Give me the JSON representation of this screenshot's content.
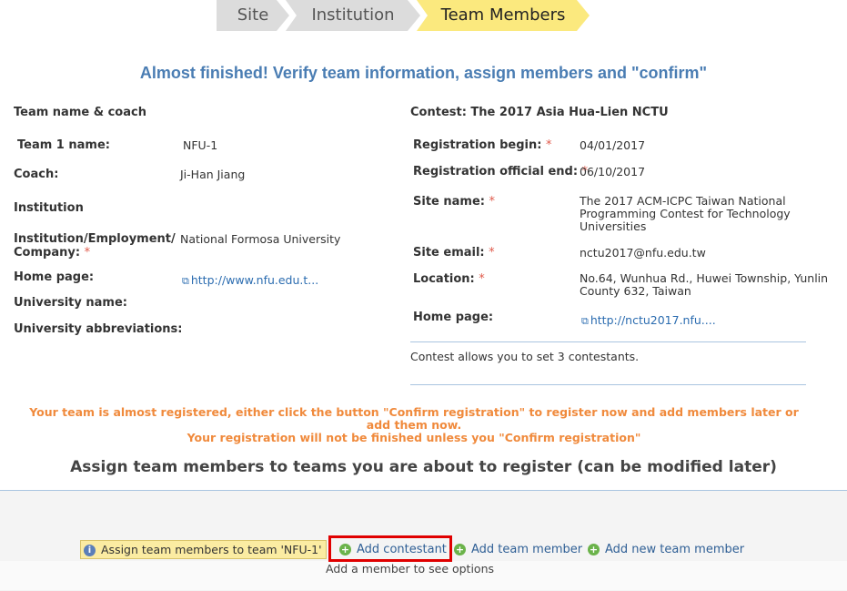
{
  "breadcrumb": {
    "steps": [
      "Site",
      "Institution",
      "Team Members"
    ]
  },
  "headline": "Almost finished! Verify team information, assign members and \"confirm\"",
  "team": {
    "section_title": "Team name & coach",
    "name_label": "Team 1 name:",
    "name_value": "NFU-1",
    "coach_label": "Coach:",
    "coach_value": "Ji-Han Jiang",
    "institution_title": "Institution",
    "institution_label_line1": "Institution/Employment/",
    "institution_label_line2": "Company:",
    "institution_value": "National Formosa University",
    "homepage_label": "Home page:",
    "homepage_value": "http://www.nfu.edu.t...",
    "university_name_label": "University name:",
    "university_abbrev_label": "University abbreviations:"
  },
  "contest": {
    "title": "Contest: The 2017 Asia Hua-Lien NCTU",
    "reg_begin_label": "Registration begin:",
    "reg_begin_value": "04/01/2017",
    "reg_end_label": "Registration official end:",
    "reg_end_value": "06/10/2017",
    "site_name_label": "Site name:",
    "site_name_value": "The 2017 ACM-ICPC Taiwan National Programming Contest for Technology Universities",
    "site_email_label": "Site email:",
    "site_email_value": "nctu2017@nfu.edu.tw",
    "location_label": "Location:",
    "location_value": "No.64, Wunhua Rd., Huwei Township, Yunlin County 632, Taiwan",
    "homepage_label": "Home page:",
    "homepage_value": "http://nctu2017.nfu....",
    "contestants_note": "Contest allows you to set 3 contestants."
  },
  "required_mark": "*",
  "notice": {
    "line1": "Your team is almost registered, either click the button \"Confirm registration\" to register now and add members later or add them now.",
    "line2": "Your registration will not be finished unless you \"Confirm registration\""
  },
  "assign_title": "Assign team members to teams you are about to register (can be modified later)",
  "assign_bar": {
    "info_label": "Assign team members to team 'NFU-1'",
    "info_icon": "i",
    "plus_icon": "+",
    "add_contestant": "Add contestant",
    "add_team_member": "Add team member",
    "add_new_team_member": "Add new team member",
    "hint": "Add a member to see options"
  }
}
